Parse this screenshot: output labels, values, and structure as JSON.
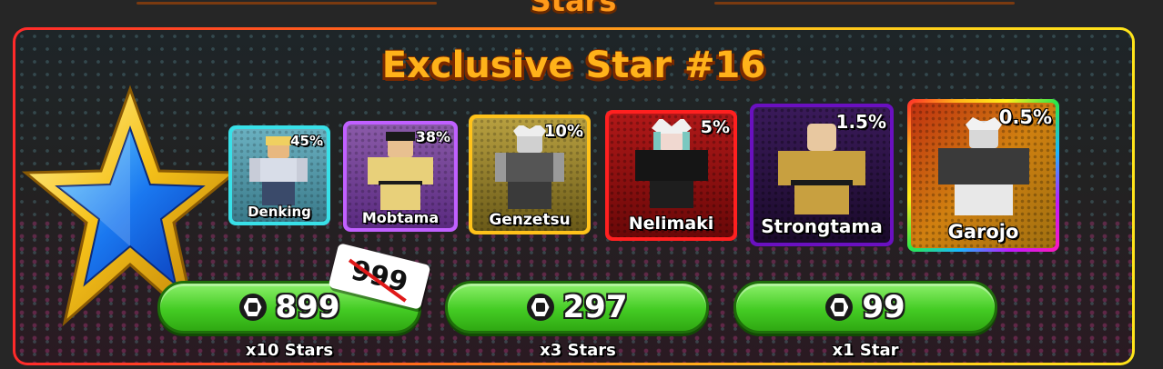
{
  "header": {
    "title": "Stars"
  },
  "banner": {
    "title": "Exclusive Star #16"
  },
  "units": [
    {
      "name": "Denking",
      "chance": "45%",
      "rarity_color": "#38e0e8"
    },
    {
      "name": "Mobtama",
      "chance": "38%",
      "rarity_color": "#c060ff"
    },
    {
      "name": "Genzetsu",
      "chance": "10%",
      "rarity_color": "#ffc21a"
    },
    {
      "name": "Nelimaki",
      "chance": "5%",
      "rarity_color": "#ff2020"
    },
    {
      "name": "Strongtama",
      "chance": "1.5%",
      "rarity_color": "#6a10c0"
    },
    {
      "name": "Garojo",
      "chance": "0.5%",
      "rarity_color": "rainbow"
    }
  ],
  "purchase_options": [
    {
      "price": "899",
      "old_price": "999",
      "caption": "x10 Stars",
      "currency_icon": "robux-icon"
    },
    {
      "price": "297",
      "caption": "x3 Stars",
      "currency_icon": "robux-icon"
    },
    {
      "price": "99",
      "caption": "x1 Star",
      "currency_icon": "robux-icon"
    }
  ]
}
